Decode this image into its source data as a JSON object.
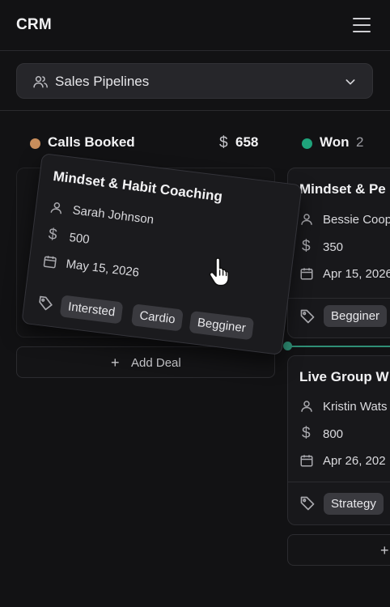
{
  "app": {
    "title": "CRM"
  },
  "pipeline_selector": {
    "label": "Sales Pipelines"
  },
  "columns": [
    {
      "title": "Calls Booked",
      "dot_color": "#c98e5c",
      "total": "658",
      "add_label": "Add Deal",
      "dragging_card": {
        "title": "Mindset & Habit Coaching",
        "contact": "Sarah Johnson",
        "amount": "500",
        "date": "May 15, 2026",
        "tags": [
          "Intersted",
          "Cardio",
          "Begginer"
        ]
      }
    },
    {
      "title": "Won",
      "dot_color": "#1fa37b",
      "count": "2",
      "add_label": "+",
      "cards": [
        {
          "title": "Mindset & Pe",
          "contact": "Bessie Coop",
          "amount": "350",
          "date": "Apr 15, 2026",
          "tags": [
            "Begginer"
          ]
        },
        {
          "title": "Live Group W",
          "contact": "Kristin Wats",
          "amount": "800",
          "date": "Apr 26, 202",
          "tags": [
            "Strategy"
          ]
        }
      ]
    }
  ],
  "icons": {
    "menu": "hamburger-icon",
    "pipeline": "users-icon",
    "chevron": "chevron-down-icon",
    "contact": "user-icon",
    "amount": "dollar-icon",
    "date": "calendar-icon",
    "tags": "tag-icon",
    "cursor": "hand-pointer-icon"
  },
  "colors": {
    "background": "#121214",
    "card": "#18181b",
    "accent_drop": "#2f8f76"
  }
}
